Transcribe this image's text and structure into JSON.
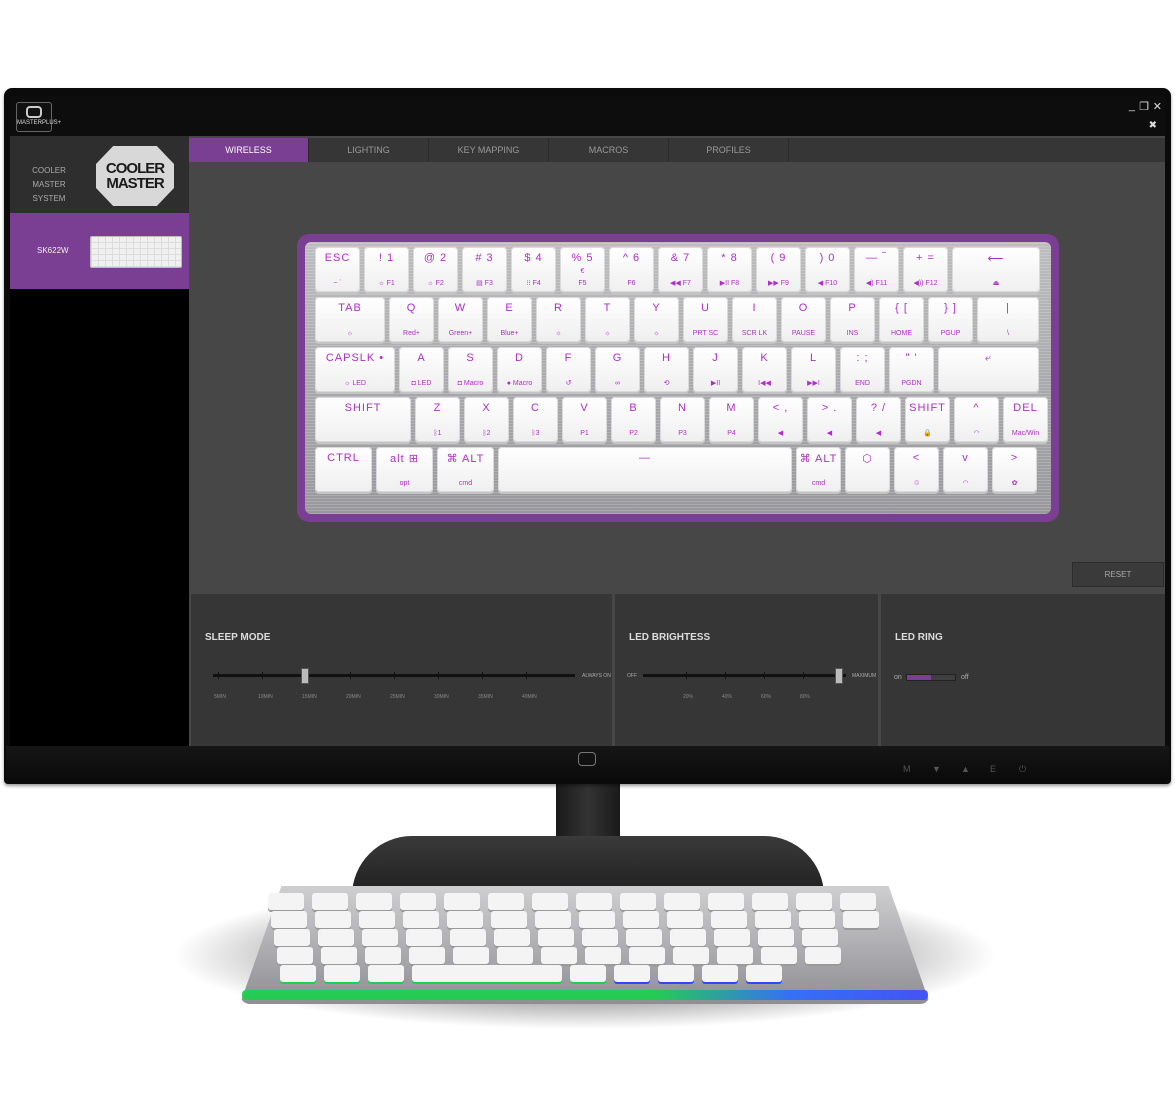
{
  "app": {
    "logo_text": "MASTERPLUS+",
    "window_controls": [
      "_",
      "❐",
      "✕"
    ],
    "pin_icon": "✖"
  },
  "sidebar": {
    "system_label_1": "COOLER MASTER",
    "system_label_2": "SYSTEM",
    "brand_logo_1": "COOLER",
    "brand_logo_2": "MASTER",
    "device_label": "SK622W"
  },
  "tabs": [
    {
      "label": "WIRELESS",
      "active": true
    },
    {
      "label": "LIGHTING",
      "active": false
    },
    {
      "label": "KEY MAPPING",
      "active": false
    },
    {
      "label": "MACROS",
      "active": false
    },
    {
      "label": "PROFILES",
      "active": false
    }
  ],
  "keyboard": {
    "rows": [
      [
        {
          "t": "ESC",
          "b": "~ `",
          "w": 45
        },
        {
          "t": "! 1",
          "b": "☼  F1",
          "w": 45
        },
        {
          "t": "@ 2",
          "b": "☼  F2",
          "w": 45
        },
        {
          "t": "# 3",
          "b": "▤  F3",
          "w": 45
        },
        {
          "t": "$ 4",
          "b": "⁝⁝  F4",
          "w": 45
        },
        {
          "t": "% 5",
          "b": "F5",
          "w": 45,
          "sub": "€"
        },
        {
          "t": "^ 6",
          "b": "F6",
          "w": 45
        },
        {
          "t": "& 7",
          "b": "◀◀  F7",
          "w": 45
        },
        {
          "t": "* 8",
          "b": "▶II  F8",
          "w": 45
        },
        {
          "t": "( 9",
          "b": "▶▶  F9",
          "w": 45
        },
        {
          "t": ") 0",
          "b": "◀  F10",
          "w": 45
        },
        {
          "t": "— ‾",
          "b": "◀)  F11",
          "w": 45
        },
        {
          "t": "+ =",
          "b": "◀))  F12",
          "w": 45
        },
        {
          "t": "⟵",
          "b": "⏏",
          "w": 88
        }
      ],
      [
        {
          "t": "TAB",
          "b": "☼",
          "w": 70
        },
        {
          "t": "Q",
          "b": "Red+",
          "w": 45
        },
        {
          "t": "W",
          "b": "Green+",
          "w": 45
        },
        {
          "t": "E",
          "b": "Blue+",
          "w": 45
        },
        {
          "t": "R",
          "b": "☼",
          "w": 45
        },
        {
          "t": "T",
          "b": "☼",
          "w": 45
        },
        {
          "t": "Y",
          "b": "☼",
          "w": 45
        },
        {
          "t": "U",
          "b": "PRT SC",
          "w": 45
        },
        {
          "t": "I",
          "b": "SCR LK",
          "w": 45
        },
        {
          "t": "O",
          "b": "PAUSE",
          "w": 45
        },
        {
          "t": "P",
          "b": "INS",
          "w": 45
        },
        {
          "t": "{ [",
          "b": "HOME",
          "w": 45
        },
        {
          "t": "} ]",
          "b": "PGUP",
          "w": 45
        },
        {
          "t": "|",
          "b": "\\",
          "w": 62
        }
      ],
      [
        {
          "t": "CAPSLK  •",
          "b": "☼ LED",
          "w": 80
        },
        {
          "t": "A",
          "b": "◘ LED",
          "w": 45
        },
        {
          "t": "S",
          "b": "◘ Macro",
          "w": 45
        },
        {
          "t": "D",
          "b": "● Macro",
          "w": 45
        },
        {
          "t": "F",
          "b": "↺",
          "w": 45
        },
        {
          "t": "G",
          "b": "∞",
          "w": 45
        },
        {
          "t": "H",
          "b": "⟲",
          "w": 45
        },
        {
          "t": "J",
          "b": "▶II",
          "w": 45
        },
        {
          "t": "K",
          "b": "I◀◀",
          "w": 45
        },
        {
          "t": "L",
          "b": "▶▶I",
          "w": 45
        },
        {
          "t": ": ;",
          "b": "END",
          "w": 45
        },
        {
          "t": "\" '",
          "b": "PGDN",
          "w": 45
        },
        {
          "t": "⤶",
          "b": "",
          "w": 101
        }
      ],
      [
        {
          "t": "SHIFT",
          "b": "",
          "w": 96
        },
        {
          "t": "Z",
          "b": "ᛒ1",
          "w": 45
        },
        {
          "t": "X",
          "b": "ᛒ2",
          "w": 45
        },
        {
          "t": "C",
          "b": "ᛒ3",
          "w": 45
        },
        {
          "t": "V",
          "b": "P1",
          "w": 45
        },
        {
          "t": "B",
          "b": "P2",
          "w": 45
        },
        {
          "t": "N",
          "b": "P3",
          "w": 45
        },
        {
          "t": "M",
          "b": "P4",
          "w": 45
        },
        {
          "t": "< ,",
          "b": "◀",
          "w": 45
        },
        {
          "t": "> .",
          "b": "◀",
          "w": 45
        },
        {
          "t": "? /",
          "b": "◀",
          "w": 45
        },
        {
          "t": "SHIFT",
          "b": "🔒",
          "w": 45
        },
        {
          "t": "^",
          "b": "◠",
          "w": 45
        },
        {
          "t": "DEL",
          "b": "Mac/Win",
          "w": 45
        }
      ],
      [
        {
          "t": "CTRL",
          "b": "",
          "w": 57
        },
        {
          "t": "alt  ⊞",
          "b": "opt",
          "w": 57
        },
        {
          "t": "⌘  ALT",
          "b": "cmd",
          "w": 57
        },
        {
          "t": "—",
          "b": "",
          "w": 294
        },
        {
          "t": "⌘  ALT",
          "b": "cmd",
          "w": 45
        },
        {
          "t": "⬡",
          "b": "",
          "w": 45
        },
        {
          "t": "<",
          "b": "♲",
          "w": 45
        },
        {
          "t": "v",
          "b": "◠",
          "w": 45
        },
        {
          "t": ">",
          "b": "✿",
          "w": 45
        }
      ]
    ]
  },
  "reset_label": "RESET",
  "sleep": {
    "title": "SLEEP MODE",
    "ticks": [
      "5MIN",
      "10MIN",
      "15MIN",
      "20MIN",
      "25MIN",
      "30MIN",
      "35MIN",
      "40MIN"
    ],
    "end_label": "ALWAYS ON",
    "selected": "15MIN"
  },
  "brightness": {
    "title": "LED BRIGHTESS",
    "start_label": "OFF",
    "ticks": [
      "20%",
      "40%",
      "60%",
      "80%"
    ],
    "end_label": "MAXIMUM",
    "selected": "MAXIMUM"
  },
  "ledring": {
    "title": "LED RING",
    "on_label": "on",
    "off_label": "off",
    "state": "on"
  },
  "bezel_controls": [
    "M",
    "▼",
    "▲",
    "E",
    "⏻"
  ],
  "colors": {
    "accent": "#7a3e92",
    "key_legend": "#b12cc8"
  }
}
